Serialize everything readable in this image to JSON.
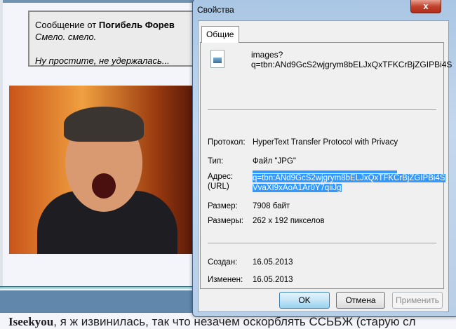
{
  "page": {
    "quote": {
      "prefix": "Сообщение от",
      "author": "Погибель Форев",
      "line1": "Смело. смело.",
      "line2": "Ну простите, не удержалась..."
    },
    "bottom": {
      "user": "Iseekyou",
      "text": ", я ж извинилась, так что незачем оскорблять ССЬБЖ (старую сл"
    }
  },
  "dialog": {
    "title": "Свойства",
    "close": "x",
    "tab": "Общие",
    "filename": [
      "images?",
      "q=tbn:ANd9GcS2wjgrym8bELJxQxTFKCrBjZGIPBi4S"
    ],
    "protocol_label": "Протокол:",
    "protocol": "HyperText Transfer Protocol with Privacy",
    "type_label": "Тип:",
    "type": "Файл \"JPG\"",
    "address_label": [
      "Адрес:",
      "(URL)"
    ],
    "address": [
      "q=tbn:ANd9GcS2wjgrym8bELJxQxTFKCrBjZGIPBi4S",
      "VvaXI9xAoA1Ar0Y7qiiJg"
    ],
    "size_label": "Размер:",
    "size": "7908 байт",
    "dims_label": "Размеры:",
    "dims": "262 x 192 пикселов",
    "created_label": "Создан:",
    "created": "16.05.2013",
    "modified_label": "Изменен:",
    "modified": "16.05.2013",
    "ok": "OK",
    "cancel": "Отмена",
    "apply": "Применить"
  }
}
